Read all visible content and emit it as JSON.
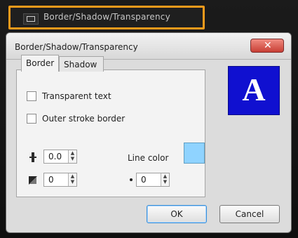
{
  "top_strip": {
    "icon": "border-shadow-icon",
    "title": "Border/Shadow/Transparency"
  },
  "dialog": {
    "title": "Border/Shadow/Transparency",
    "close_glyph": "✕",
    "tabs": [
      {
        "label": "Border"
      },
      {
        "label": "Shadow"
      }
    ],
    "border_tab": {
      "transparent_text": "Transparent text",
      "outer_stroke_border": "Outer stroke border",
      "stroke_width_value": "0.0",
      "line_color_label": "Line color",
      "line_color": "#8fd3ff",
      "corner_value": "0",
      "dot_value": "0",
      "up_arrow": "▲",
      "down_arrow": "▼"
    },
    "preview_letter": "A",
    "buttons": {
      "ok": "OK",
      "cancel": "Cancel"
    }
  }
}
